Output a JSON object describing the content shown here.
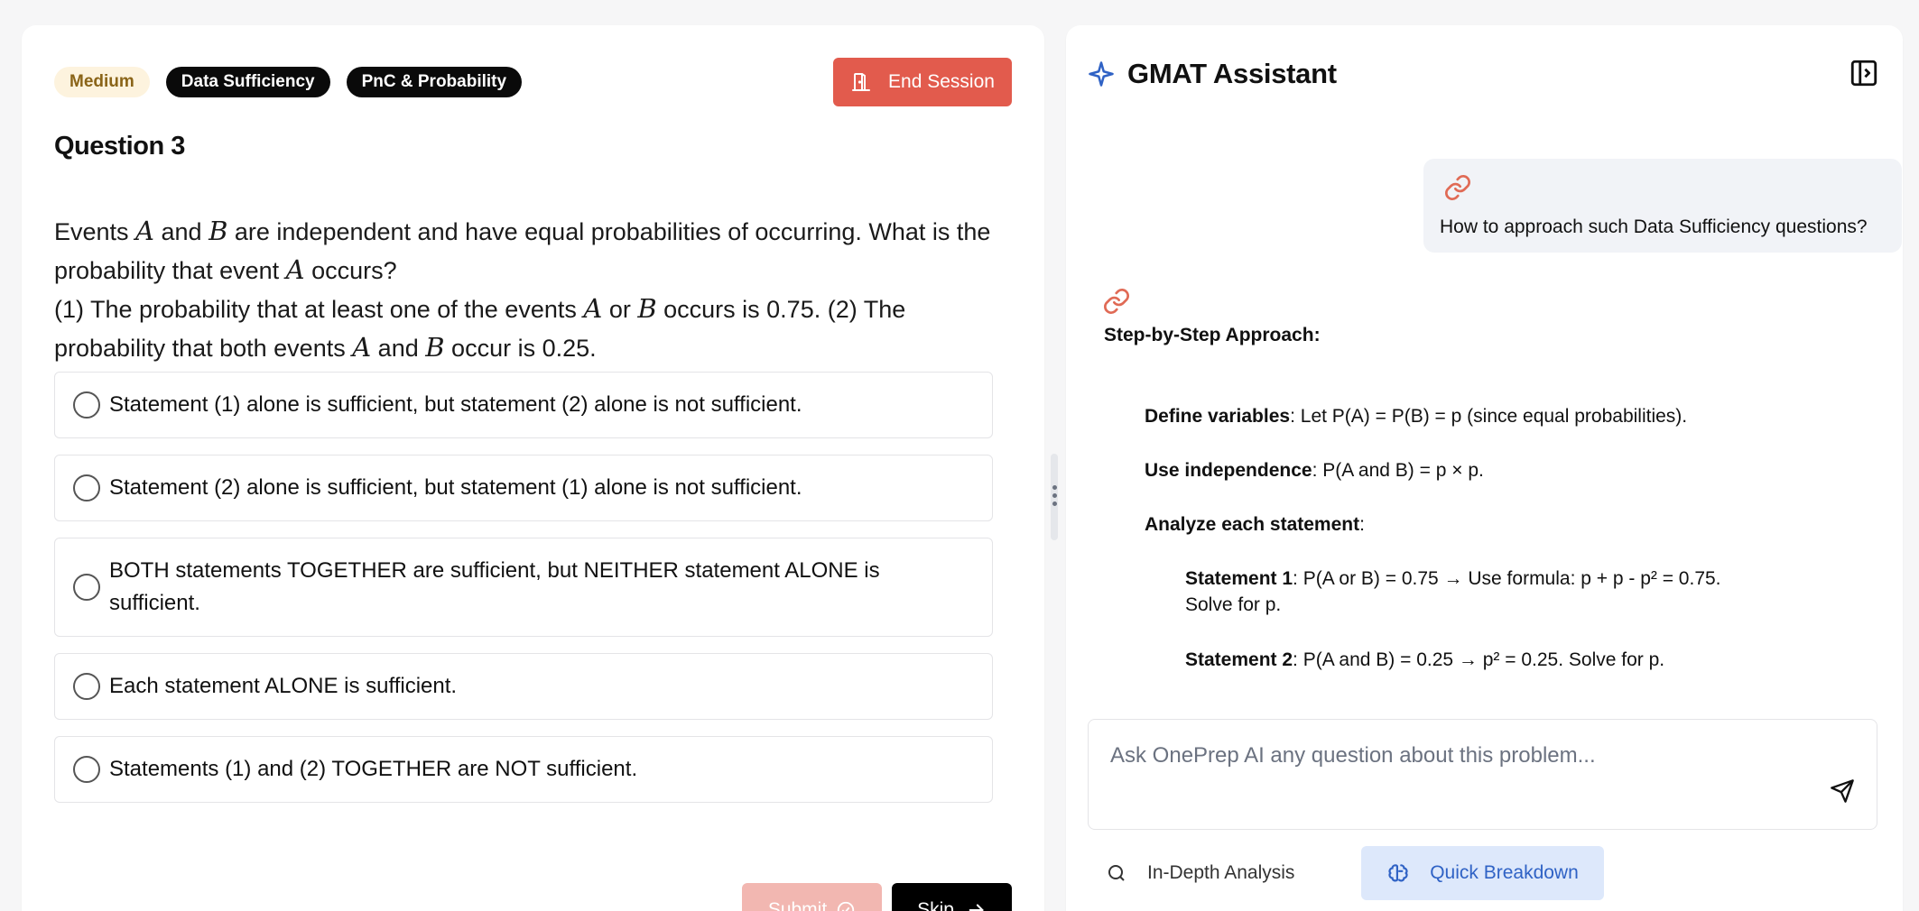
{
  "question": {
    "tags": {
      "difficulty": "Medium",
      "type": "Data Sufficiency",
      "topic": "PnC & Probability"
    },
    "end_session_label": "End Session",
    "title": "Question 3",
    "text": {
      "p1": "Events ",
      "v1": "A",
      "p2": " and ",
      "v2": "B",
      "p3": " are independent and have equal probabilities of occurring. What is the probability that event ",
      "v3": "A",
      "p4": " occurs?",
      "p5": "(1) The probability that at least one of the events ",
      "v4": "A",
      "p6": " or ",
      "v5": "B",
      "p7": " occurs is 0.75. (2) The probability that both events ",
      "v6": "A",
      "p8": " and ",
      "v7": "B",
      "p9": " occur is 0.25."
    },
    "options": [
      "Statement (1) alone is sufficient, but statement (2) alone is not sufficient.",
      "Statement (2) alone is sufficient, but statement (1) alone is not sufficient.",
      "BOTH statements TOGETHER are sufficient, but NEITHER statement ALONE is sufficient.",
      "Each statement ALONE is sufficient.",
      "Statements (1) and (2) TOGETHER are NOT sufficient."
    ],
    "submit_label": "Submit",
    "skip_label": "Skip"
  },
  "assistant": {
    "title": "GMAT Assistant",
    "user_message": "How to approach such Data Sufficiency questions?",
    "response": {
      "heading": "Step-by-Step Approach:",
      "step1_bold": "Define variables",
      "step1_text": ": Let P(A) = P(B) = p (since equal probabilities).",
      "step2_bold": "Use independence",
      "step2_text": ": P(A and B) = p × p.",
      "step3_bold": "Analyze each statement",
      "step3_text": ":",
      "s1_bold": "Statement 1",
      "s1_text": ": P(A or B) = 0.75 → Use formula: p + p - p² = 0.75.",
      "s1_text2": "Solve for p.",
      "s2_bold": "Statement 2",
      "s2_text": ": P(A and B) = 0.25 → p² = 0.25. Solve for p."
    },
    "input_placeholder": "Ask OnePrep AI any question about this problem...",
    "modes": {
      "in_depth": "In-Depth Analysis",
      "quick": "Quick Breakdown"
    }
  },
  "colors": {
    "end_session": "#e25b4d",
    "accent_blue": "#2f62c5",
    "link_icon": "#e06a55",
    "medium_tag_bg": "#fdf3de"
  }
}
